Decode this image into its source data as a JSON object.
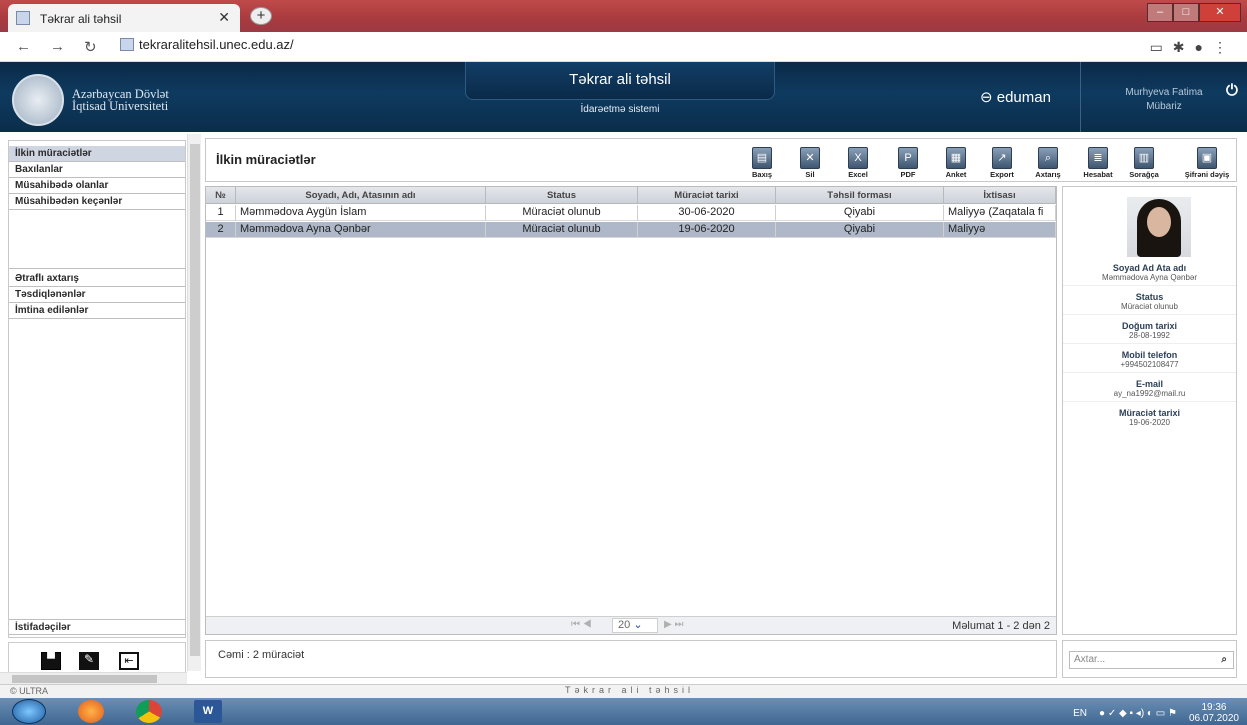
{
  "browser": {
    "tab_title": "Təkrar ali təhsil",
    "url": "tekraralitehsil.unec.edu.az/"
  },
  "header": {
    "uni_line1": "Azərbaycan Dövlət",
    "uni_line2": "İqtisad Universiteti",
    "app_title": "Təkrar ali təhsil",
    "app_subtitle": "İdarəetmə sistemi",
    "brand": "eduman",
    "user_line1": "Murhyeva Fatima",
    "user_line2": "Mübariz"
  },
  "sidebar": {
    "items": [
      "İlkin müraciətlər",
      "Baxılanlar",
      "Müsahibədə olanlar",
      "Müsahibədən keçənlər"
    ],
    "items2": [
      "Ətraflı axtarış",
      "Təsdiqlənənlər",
      "İmtina edilənlər"
    ],
    "bottom_item": "İstifadəçilər"
  },
  "main": {
    "title": "İlkin müraciətlər",
    "toolbar": [
      "Baxış",
      "Sil",
      "Excel",
      "PDF",
      "Anket",
      "Export",
      "Axtarış",
      "Hesabat",
      "Sorağça",
      "Şifrəni dəyiş"
    ]
  },
  "table": {
    "columns": [
      "№",
      "Soyadı, Adı, Atasının adı",
      "Status",
      "Müraciət tarixi",
      "Təhsil forması",
      "İxtisası"
    ],
    "rows": [
      [
        "1",
        "Məmmədova Aygün İslam",
        "Müraciət olunub",
        "30-06-2020",
        "Qiyabi",
        "Maliyyə (Zaqatala fi"
      ],
      [
        "2",
        "Məmmədova Ayna Qənbər",
        "Müraciət olunub",
        "19-06-2020",
        "Qiyabi",
        "Maliyyə"
      ]
    ],
    "page_size": "20",
    "info": "Məlumat 1 - 2 dən 2"
  },
  "detail": {
    "fields": [
      {
        "label": "Soyad Ad Ata adı",
        "value": "Məmmədova Ayna Qənbər"
      },
      {
        "label": "Status",
        "value": "Müraciət olunub"
      },
      {
        "label": "Doğum tarixi",
        "value": "28-08-1992"
      },
      {
        "label": "Mobil telefon",
        "value": "+994502108477"
      },
      {
        "label": "E-mail",
        "value": "ay_na1992@mail.ru"
      },
      {
        "label": "Müraciət tarixi",
        "value": "19-06-2020"
      }
    ]
  },
  "footer": {
    "total": "Cəmi : 2 müraciət",
    "search_placeholder": "Axtar..."
  },
  "statusbar": {
    "left": "© ULTRA",
    "center": "Təkrar ali təhsil"
  },
  "taskbar": {
    "lang": "EN",
    "time": "19:36",
    "date": "06.07.2020"
  }
}
